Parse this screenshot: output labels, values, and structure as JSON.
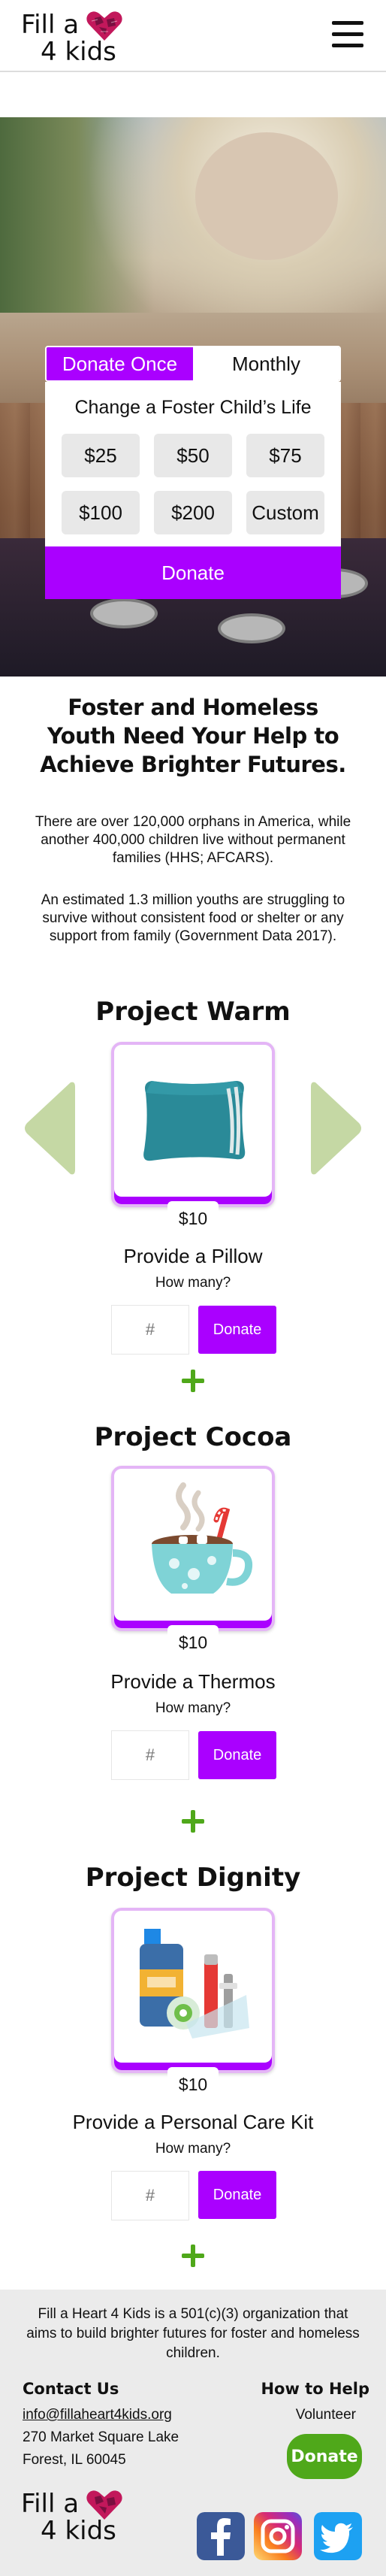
{
  "header": {
    "logo_line1": "Fill a",
    "logo_line2": "4 kids",
    "menu_icon": "hamburger-menu-icon"
  },
  "hero": {
    "tabs": [
      "Donate Once",
      "Monthly"
    ],
    "card_title": "Change a Foster Child’s Life",
    "amounts": [
      "$25",
      "$50",
      "$75",
      "$100",
      "$200",
      "Custom"
    ],
    "donate_label": "Donate"
  },
  "mission": {
    "title": "Foster and Homeless Youth Need Your Help to Achieve Brighter Futures.",
    "p1": "There are over 120,000 orphans in America, while another 400,000 children live without permanent families (HHS; AFCARS).",
    "p2": "An estimated 1.3 million youths are struggling to survive without consistent food or shelter or any support from family (Government Data 2017)."
  },
  "projects": [
    {
      "title": "Project Warm",
      "price": "$10",
      "name": "Provide a Pillow",
      "how_many": "How many?",
      "qty_placeholder": "#",
      "donate": "Donate",
      "icon": "pillow-icon"
    },
    {
      "title": "Project Cocoa",
      "price": "$10",
      "name": "Provide a Thermos",
      "how_many": "How many?",
      "qty_placeholder": "#",
      "donate": "Donate",
      "icon": "hot-cocoa-mug-icon"
    },
    {
      "title": "Project Dignity",
      "price": "$10",
      "name": "Provide a Personal Care Kit",
      "how_many": "How many?",
      "qty_placeholder": "#",
      "donate": "Donate",
      "icon": "personal-care-kit-icon"
    }
  ],
  "footer": {
    "about": "Fill a Heart 4 Kids is a 501(c)(3) organization that aims to build brighter futures for foster and homeless children.",
    "contact_heading": "Contact Us",
    "email": "info@fillaheart4kids.org",
    "address1": "270 Market Square Lake",
    "address2": "Forest, IL 60045",
    "help_heading": "How to Help",
    "volunteer": "Volunteer",
    "donate": "Donate",
    "logo_line1": "Fill a",
    "logo_line2": "4 kids",
    "social": [
      "facebook-icon",
      "instagram-icon",
      "twitter-icon"
    ]
  },
  "colors": {
    "accent": "#aa00ff",
    "accent_light": "#e4b5f6",
    "green": "#4fa81a",
    "arrow_green": "#c5d8a4",
    "facebook": "#3b5998",
    "twitter": "#1da1f2"
  }
}
